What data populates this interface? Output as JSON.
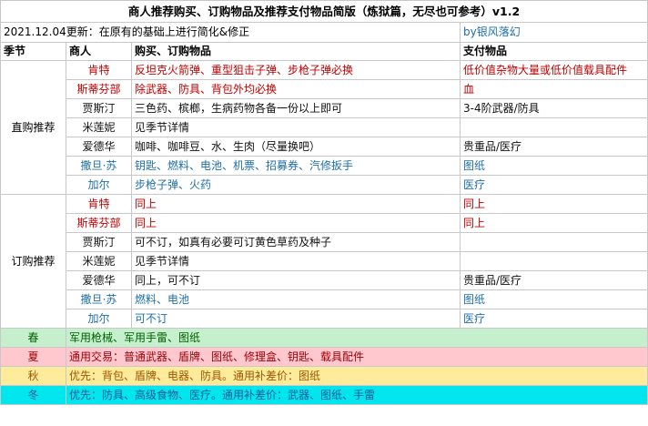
{
  "title": "商人推荐购买、订购物品及推荐支付物品简版（炼狱篇，无尽也可参考）v1.2",
  "update_note": "2021.12.04更新：在原有的基础上进行简化&修正",
  "author": "by银风落幻",
  "headers": [
    "季节",
    "商人",
    "购买、订购物品",
    "支付物品"
  ],
  "groups": [
    {
      "label": "直购推荐",
      "rows": [
        {
          "merchant": "肯特",
          "items": "反坦克火箭弹、重型狙击子弹、步枪子弹必换",
          "pay": "低价值杂物大量或低价值载具配件",
          "color": "red"
        },
        {
          "merchant": "斯蒂芬部",
          "items": "除武器、防具、背包外均必换",
          "pay": "血",
          "color": "red"
        },
        {
          "merchant": "贾斯汀",
          "items": "三色药、槟榔，生病药物各备一份以上即可",
          "pay": "3-4阶武器/防具",
          "color": "black"
        },
        {
          "merchant": "米莲妮",
          "items": "见季节详情",
          "pay": "",
          "color": "black"
        },
        {
          "merchant": "爱德华",
          "items": "咖啡、咖啡豆、水、生肉（尽量换吧）",
          "pay": "贵重品/医疗",
          "color": "black"
        },
        {
          "merchant": "撒旦·苏",
          "items": "钥匙、燃料、电池、机票、招募券、汽修扳手",
          "pay": "图纸",
          "color": "blue"
        },
        {
          "merchant": "加尔",
          "items": "步枪子弹、火药",
          "pay": "医疗",
          "color": "blue"
        }
      ]
    },
    {
      "label": "订购推荐",
      "rows": [
        {
          "merchant": "肯特",
          "items": "同上",
          "pay": "同上",
          "color": "red"
        },
        {
          "merchant": "斯蒂芬部",
          "items": "同上",
          "pay": "同上",
          "color": "red"
        },
        {
          "merchant": "贾斯汀",
          "items": "可不订，如真有必要可订黄色草药及种子",
          "pay": "",
          "color": "black"
        },
        {
          "merchant": "米莲妮",
          "items": "见季节详情",
          "pay": "",
          "color": "black"
        },
        {
          "merchant": "爱德华",
          "items": "同上，可不订",
          "pay": "贵重品/医疗",
          "color": "black"
        },
        {
          "merchant": "撒旦·苏",
          "items": "燃料、电池",
          "pay": "图纸",
          "color": "blue"
        },
        {
          "merchant": "加尔",
          "items": "可不订",
          "pay": "医疗",
          "color": "blue"
        }
      ]
    }
  ],
  "seasons": [
    {
      "name": "春",
      "text": "军用枪械、军用手雷、图纸",
      "bg": "#c6efce"
    },
    {
      "name": "夏",
      "text": "通用交易：普通武器、盾牌、图纸、修理盒、钥匙、载具配件",
      "bg": "#ffc7ce"
    },
    {
      "name": "秋",
      "text": "优先：背包、盾牌、电器、防具。通用补差价：图纸",
      "bg": "#ffeb9c"
    },
    {
      "name": "冬",
      "text": "优先：防具、高级食物、医疗。通用补差价：武器、图纸、手雷",
      "bg": "#00e5ee"
    }
  ],
  "colors": {
    "red": "#c00000",
    "blue": "#1f6fa8",
    "grid": "#c8c8c8"
  }
}
